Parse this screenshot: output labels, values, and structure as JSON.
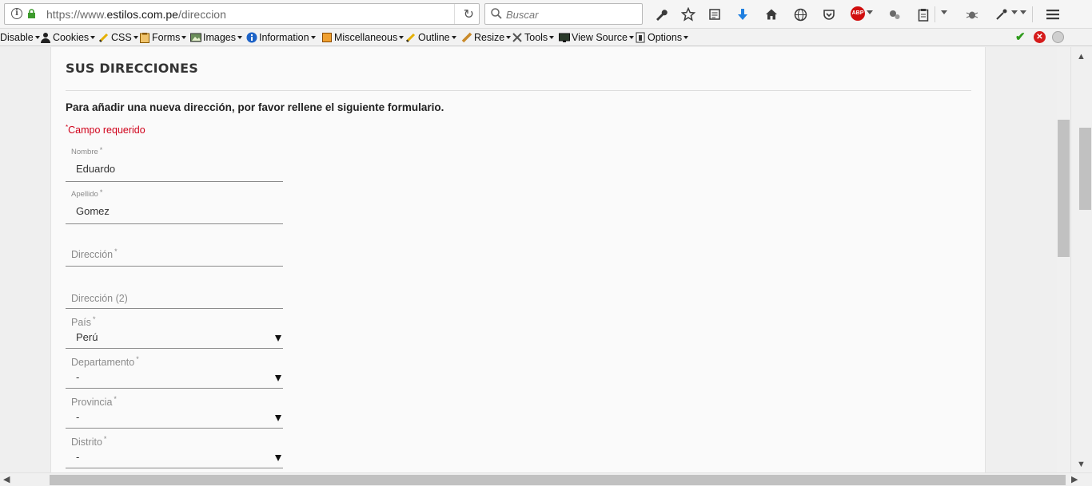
{
  "browser": {
    "url_prefix": "https://www.",
    "url_host": "estilos.com.pe",
    "url_path": "/direccion",
    "search_placeholder": "Buscar",
    "adblock_label": "ABP"
  },
  "toolbar": {
    "icons": [
      "wrench-icon",
      "star-icon",
      "reader-icon",
      "download-icon",
      "home-icon",
      "globe-icon",
      "pocket-icon",
      "adblock-icon",
      "extension-icon",
      "clipboard-icon",
      "bug-icon",
      "eyedropper-icon",
      "menu-icon"
    ]
  },
  "extension_bar": {
    "items": [
      {
        "label": "Disable",
        "icon": ""
      },
      {
        "label": "Cookies",
        "icon": "user-icon"
      },
      {
        "label": "CSS",
        "icon": "pencil-icon"
      },
      {
        "label": "Forms",
        "icon": "clipboard-icon"
      },
      {
        "label": "Images",
        "icon": "image-icon"
      },
      {
        "label": "Information",
        "icon": "info-icon"
      },
      {
        "label": "Miscellaneous",
        "icon": "box-icon"
      },
      {
        "label": "Outline",
        "icon": "pencil-icon"
      },
      {
        "label": "Resize",
        "icon": "ruler-icon"
      },
      {
        "label": "Tools",
        "icon": "tools-icon"
      },
      {
        "label": "View Source",
        "icon": "monitor-icon"
      },
      {
        "label": "Options",
        "icon": "document-icon"
      }
    ],
    "status_colors": {
      "ok": "#2e9a1b",
      "error": "#d51b1b"
    }
  },
  "page": {
    "title": "SUS DIRECCIONES",
    "intro": "Para añadir una nueva dirección, por favor rellene el siguiente formulario.",
    "required_marker": "*",
    "required_note": "Campo requerido"
  },
  "form": {
    "fields": [
      {
        "label": "Nombre",
        "required": "*",
        "value": "Eduardo"
      },
      {
        "label": "Apellido",
        "required": "*",
        "value": "Gomez"
      },
      {
        "label": "Dirección",
        "required": "*",
        "value": ""
      },
      {
        "label": "Dirección (2)",
        "required": "",
        "value": ""
      },
      {
        "label": "País",
        "required": "*",
        "value": "Perú"
      },
      {
        "label": "Departamento",
        "required": "*",
        "value": "-"
      },
      {
        "label": "Provincia",
        "required": "*",
        "value": "-"
      },
      {
        "label": "Distrito",
        "required": "*",
        "value": "-"
      }
    ]
  },
  "colors": {
    "accent_required": "#d0021b",
    "text": "#333333"
  }
}
